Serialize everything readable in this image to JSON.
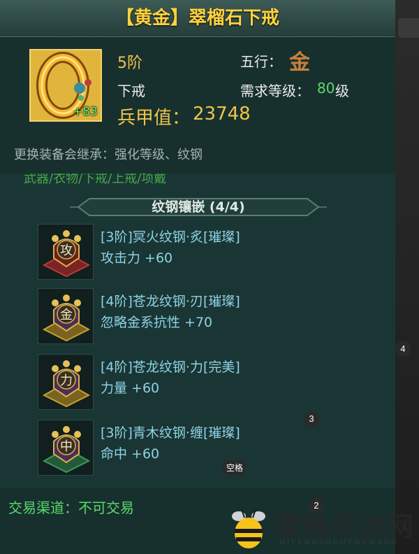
{
  "title": "【黄金】翠榴石下戒",
  "item": {
    "icon_name": "gold-ring-icon",
    "enhance_level": "+83",
    "tier": "5阶",
    "slot": "下戒",
    "element_label": "五行：",
    "element_icon": "金",
    "req_level_label": "需求等级：",
    "req_level_value": "80",
    "req_level_unit": "级",
    "power_label": "兵甲值：",
    "power_value": "23748"
  },
  "inherit_note": "更换装备会继承：强化等级、纹钢",
  "truncated_categories": "武器/衣物/下戒/上戒/项戴",
  "inlay": {
    "header": "纹钢镶嵌 (4/4)",
    "gems": [
      {
        "symbol": "攻",
        "color": "#b83a3a",
        "name": "[3阶]冥火纹钢·炙[璀璨]",
        "stat": "攻击力   +60"
      },
      {
        "symbol": "金",
        "color": "#c8a12e",
        "name": "[4阶]苍龙纹钢·刃[璀璨]",
        "stat": "忽略金系抗性   +70"
      },
      {
        "symbol": "力",
        "color": "#c8a12e",
        "name": "[4阶]苍龙纹钢·力[完美]",
        "stat": "力量   +60"
      },
      {
        "symbol": "中",
        "color": "#3a9a5a",
        "name": "[3阶]青木纹钢·缠[璀璨]",
        "stat": "命中   +60"
      }
    ]
  },
  "trade": "交易渠道：不可交易",
  "overlay_badges": {
    "b4": "4",
    "b3": "3",
    "b2": "2",
    "space": "空格"
  },
  "watermark": {
    "cn": "蜜蜂手游网",
    "en": "MIFENGSHOUYOUWANG"
  },
  "colors": {
    "title": "#ffd23e",
    "gold_text": "#f0c34a",
    "gem_text": "#8fd2e6",
    "trade_text": "#5ad96a"
  }
}
